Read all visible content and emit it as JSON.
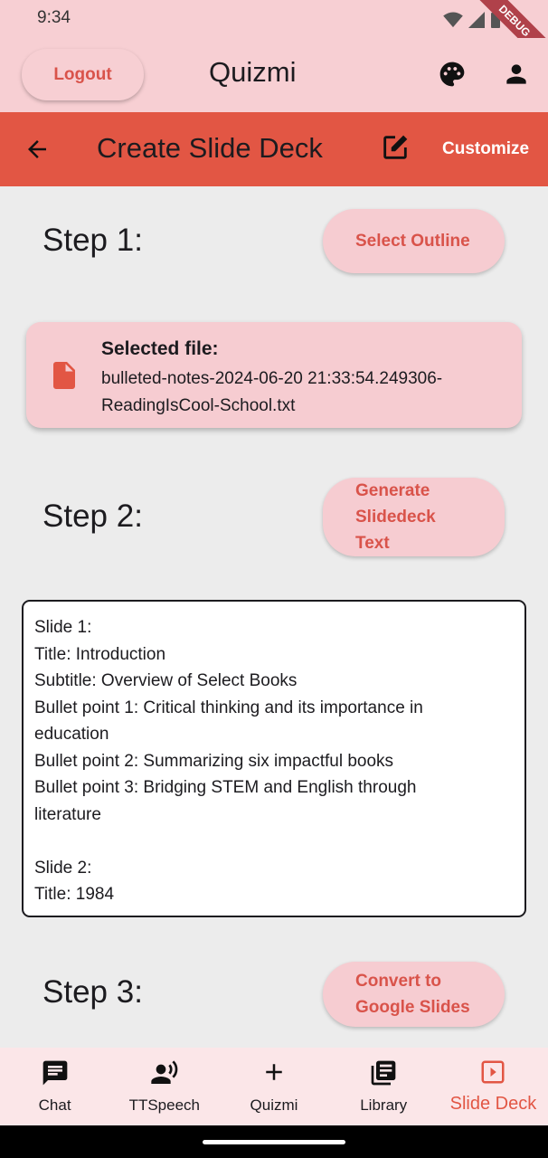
{
  "status_bar": {
    "time": "9:34",
    "debug_banner": "DEBUG"
  },
  "app_bar": {
    "logout_label": "Logout",
    "title": "Quizmi",
    "palette_icon": "palette-icon",
    "account_icon": "person-icon"
  },
  "page_bar": {
    "title": "Create Slide Deck",
    "customize_label": "Customize",
    "back_icon": "arrow-back-icon",
    "edit_icon": "edit-note-icon"
  },
  "steps": [
    {
      "label": "Step 1:",
      "button": "Select Outline"
    },
    {
      "label": "Step 2:",
      "button_lines": [
        "Generate",
        "Slidedeck",
        "Text"
      ]
    },
    {
      "label": "Step 3:",
      "button_lines": [
        "Convert to",
        "Google Slides"
      ]
    }
  ],
  "file_card": {
    "heading": "Selected file:",
    "filename_lines": [
      "bulleted-notes-2024-06-20 21:33:54.249306-",
      "ReadingIsCool-School.txt"
    ]
  },
  "slide_text": [
    "Slide 1:",
    "Title: Introduction",
    "Subtitle: Overview of Select Books",
    "Bullet point 1: Critical thinking and its importance in",
    "education",
    "Bullet point 2: Summarizing six impactful books",
    "Bullet point 3: Bridging STEM and English through",
    "literature",
    "",
    "Slide 2:",
    "Title: 1984"
  ],
  "bottom_nav": [
    {
      "label": "Chat",
      "icon": "chat-icon"
    },
    {
      "label": "TTSpeech",
      "icon": "record-voice-icon"
    },
    {
      "label": "Quizmi",
      "icon": "add-icon"
    },
    {
      "label": "Library",
      "icon": "library-books-icon"
    },
    {
      "label": "Slide Deck",
      "icon": "slideshow-icon",
      "active": true
    }
  ],
  "colors": {
    "accent": "#e25644",
    "pink": "#f7cfd3",
    "button_text": "#d9534a",
    "background": "#ececec"
  }
}
